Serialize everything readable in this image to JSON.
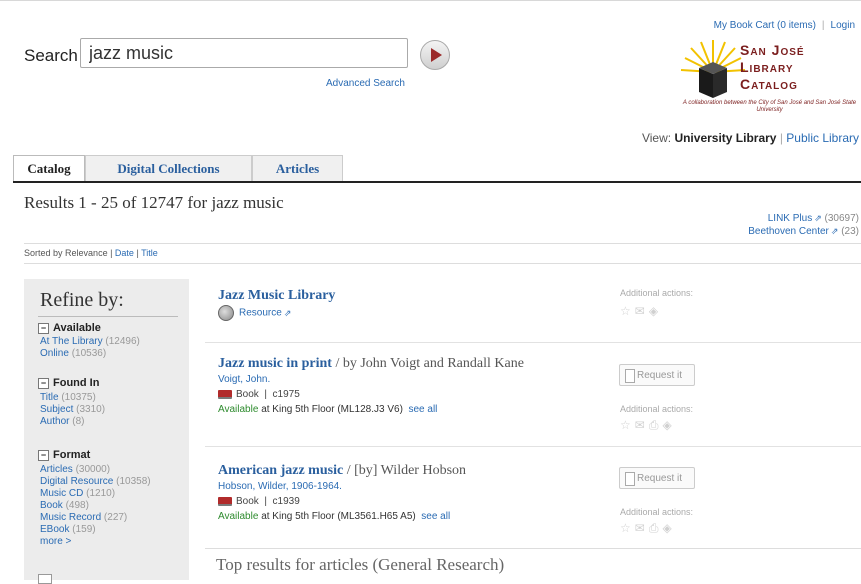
{
  "header": {
    "search_label": "Search",
    "search_value": "jazz music",
    "advanced_search": "Advanced Search",
    "my_book_cart": "My Book Cart (0 items)",
    "login": "Login",
    "logo_title": "San José Library Catalog",
    "logo_tagline": "A collaboration between the City of San José and San José State University",
    "view_label": "View:",
    "view_university": "University Library",
    "view_public": "Public Library"
  },
  "tabs": [
    {
      "label": "Catalog",
      "active": true
    },
    {
      "label": "Digital Collections",
      "active": false
    },
    {
      "label": "Articles",
      "active": false
    }
  ],
  "results_heading": "Results 1 - 25 of 12747 for jazz music",
  "external_links": [
    {
      "label": "LINK Plus",
      "count": "(30697)"
    },
    {
      "label": "Beethoven Center",
      "count": "(23)"
    }
  ],
  "sort": {
    "label": "Sorted by",
    "options": [
      "Relevance",
      "Date",
      "Title"
    ]
  },
  "sidebar": {
    "title": "Refine by:",
    "facets": [
      {
        "heading": "Available",
        "items": [
          {
            "label": "At The Library",
            "count": "(12496)"
          },
          {
            "label": "Online",
            "count": "(10536)"
          }
        ]
      },
      {
        "heading": "Found In",
        "items": [
          {
            "label": "Title",
            "count": "(10375)"
          },
          {
            "label": "Subject",
            "count": "(3310)"
          },
          {
            "label": "Author",
            "count": "(8)"
          }
        ]
      },
      {
        "heading": "Format",
        "items": [
          {
            "label": "Articles",
            "count": "(30000)"
          },
          {
            "label": "Digital Resource",
            "count": "(10358)"
          },
          {
            "label": "Music CD",
            "count": "(1210)"
          },
          {
            "label": "Book",
            "count": "(498)"
          },
          {
            "label": "Music Record",
            "count": "(227)"
          },
          {
            "label": "EBook",
            "count": "(159)"
          },
          {
            "label": "more >",
            "count": ""
          }
        ]
      }
    ]
  },
  "results": [
    {
      "title": "Jazz Music Library",
      "responsibility": "",
      "format": "Resource",
      "additional_actions": "Additional actions:"
    },
    {
      "title": "Jazz music in print",
      "responsibility": "/ by John Voigt and Randall Kane",
      "author": "Voigt, John.",
      "format": "Book",
      "date": "c1975",
      "available": "Available",
      "location": "at King 5th Floor (ML128.J3 V6)",
      "see_all": "see all",
      "request": "Request it",
      "additional_actions": "Additional actions:"
    },
    {
      "title": "American jazz music",
      "responsibility": "/ [by] Wilder Hobson",
      "author": "Hobson, Wilder, 1906-1964.",
      "format": "Book",
      "date": "c1939",
      "available": "Available",
      "location": "at King 5th Floor (ML3561.H65 A5)",
      "see_all": "see all",
      "request": "Request it",
      "additional_actions": "Additional actions:"
    }
  ],
  "top_results": "Top results for articles (General Research)",
  "colors": {
    "brand": "#7b1e1e",
    "link": "#2a6bb3",
    "available": "#2e8b2e"
  }
}
